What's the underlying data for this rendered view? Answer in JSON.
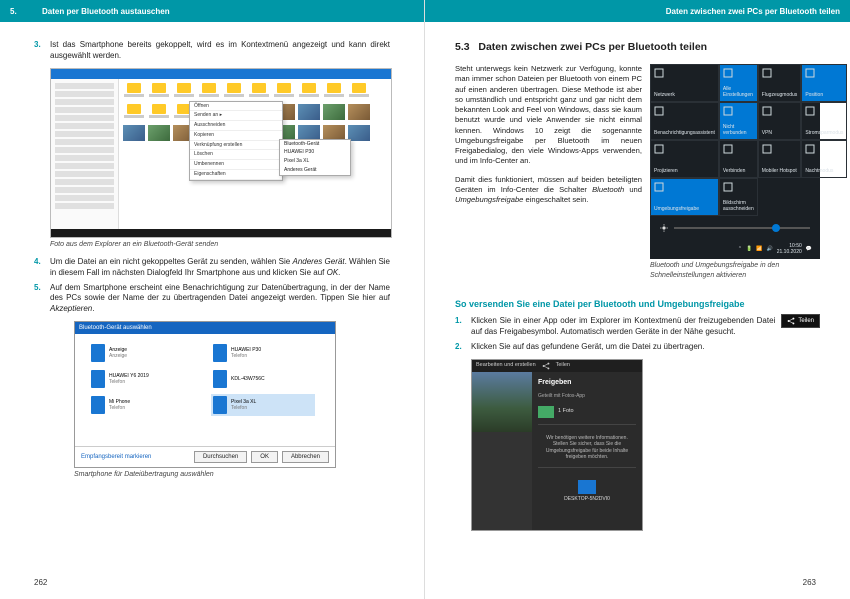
{
  "left": {
    "header": {
      "chapter_num": "5.",
      "chapter_title": "Daten per Bluetooth austauschen"
    },
    "items": [
      {
        "n": "3.",
        "text": "Ist das Smartphone bereits gekoppelt, wird es im Kontextmenü angezeigt und kann direkt ausgewählt werden."
      }
    ],
    "fig1_caption": "Foto aus dem Explorer an ein Bluetooth-Gerät senden",
    "items2": [
      {
        "n": "4.",
        "text_pre": "Um die Datei an ein nicht gekoppeltes Gerät zu senden, wählen Sie ",
        "em1": "Anderes Gerät",
        "text_mid": ". Wählen Sie in diesem Fall im nächsten Dialogfeld Ihr Smartphone aus und klicken Sie auf ",
        "em2": "OK",
        "text_post": "."
      },
      {
        "n": "5.",
        "text_pre": "Auf dem Smartphone erscheint eine Benachrichtigung zur Datenübertragung, in der der Name des PCs sowie der Name der zu übertragenden Datei angezeigt werden. Tippen Sie hier auf ",
        "em1": "Akzeptieren",
        "text_post": "."
      }
    ],
    "btdlg": {
      "title": "Bluetooth-Gerät auswählen",
      "devices": [
        {
          "name": "Anzeige",
          "type": "Anzeige"
        },
        {
          "name": "HUAWEI P30",
          "type": "Telefon"
        },
        {
          "name": "HUAWEI Y6 2019",
          "type": "Telefon"
        },
        {
          "name": "KDL-43W756C",
          "type": ""
        },
        {
          "name": "Mi Phone",
          "type": "Telefon"
        },
        {
          "name": "Pixel 3a XL",
          "type": "Telefon",
          "selected": true
        }
      ],
      "link": "Empfangsbereit markieren",
      "browse": "Durchsuchen",
      "ok": "OK",
      "cancel": "Abbrechen"
    },
    "fig2_caption": "Smartphone für Dateiübertragung auswählen",
    "page_num": "262"
  },
  "right": {
    "header": {
      "section_title": "Daten zwischen zwei PCs per Bluetooth teilen"
    },
    "section_num": "5.3",
    "section_title": "Daten zwischen zwei PCs per Bluetooth teilen",
    "para1": "Steht unterwegs kein Netzwerk zur Verfügung, konnte man immer schon Dateien per Bluetooth von einem PC auf einen anderen übertragen. Diese Methode ist aber so umständlich und entspricht ganz und gar nicht dem bekannten Look and Feel von Windows, dass sie kaum benutzt wurde und viele Anwender sie nicht einmal kennen. Windows 10 zeigt die sogenannte Umgebungsfreigabe per Bluetooth im neuen Freigabedialog, den viele Windows-Apps verwenden, und im Info-Center an.",
    "para2_pre": "Damit dies funktioniert, müssen auf beiden beteiligten Geräten im Info-Center die Schalter ",
    "para2_em1": "Bluetooth",
    "para2_mid": " und ",
    "para2_em2": "Umgebungsfreigabe",
    "para2_post": " eingeschaltet sein.",
    "ac": {
      "tiles": [
        {
          "label": "Netzwerk",
          "on": false
        },
        {
          "label": "Alle Einstellungen",
          "on": true
        },
        {
          "label": "Flugzeugmodus",
          "on": false
        },
        {
          "label": "Position",
          "on": true
        },
        {
          "label": "Benachrichtigungsassistent",
          "on": false
        },
        {
          "label": "Nicht verbunden",
          "on": true
        },
        {
          "label": "VPN",
          "on": false
        },
        {
          "label": "Stromsparmodus",
          "on": false
        },
        {
          "label": "Projizieren",
          "on": false
        },
        {
          "label": "Verbinden",
          "on": false
        },
        {
          "label": "Mobiler Hotspot",
          "on": false
        },
        {
          "label": "Nachtmodus",
          "on": false
        },
        {
          "label": "Umgebungsfreigabe",
          "on": true
        },
        {
          "label": "Bildschirm ausschneiden",
          "on": false
        }
      ],
      "time": "10:50",
      "date": "21.10.2020"
    },
    "ac_caption": "Bluetooth und Umgebungsfreigabe in den Schnelleinstellungen aktivieren",
    "subhead": "So versenden Sie eine Datei per Bluetooth und Umgebungsfreigabe",
    "steps": [
      {
        "n": "1.",
        "text": "Klicken Sie in einer App oder im Explorer im Kontextmenü der freizugebenden Datei auf das Freigabesymbol. Automatisch werden Geräte in der Nähe gesucht."
      },
      {
        "n": "2.",
        "text": "Klicken Sie auf das gefundene Gerät, um die Datei zu übertragen."
      }
    ],
    "teilen": "Teilen",
    "share": {
      "topbar": [
        "Bearbeiten und erstellen",
        "Teilen"
      ],
      "title": "Freigeben",
      "subtitle": "Geteilt mit Fotos-App",
      "file": "1 Foto",
      "msg1": "Wir benötigen weitere Informationen.",
      "msg2": "Stellen Sie sicher, dass Sie die Umgebungsfreigabe für beide Inhalte freigeben möchten.",
      "device": "DESKTOP-5N2DVI0"
    },
    "page_num": "263"
  }
}
